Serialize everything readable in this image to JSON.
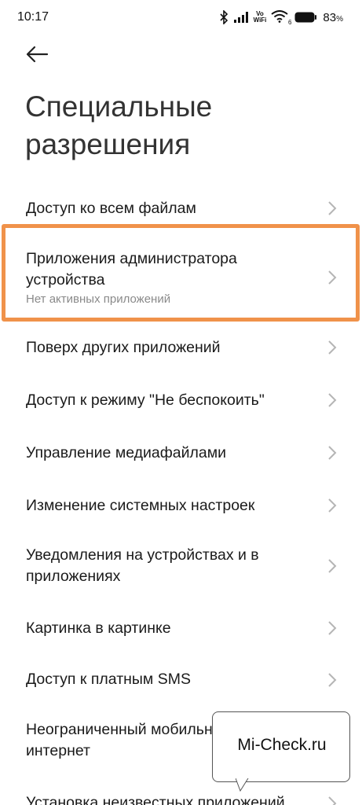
{
  "status_bar": {
    "time": "10:17",
    "volte_top": "Vo",
    "volte_bottom": "WiFi",
    "wifi_badge": "6",
    "battery_percent": "83",
    "battery_percent_sign": "%",
    "icons": [
      "bluetooth-icon",
      "signal-icon",
      "wifi-icon",
      "battery-icon"
    ]
  },
  "header": {
    "back_icon": "arrow-left-icon",
    "title": "Специальные разрешения"
  },
  "items": [
    {
      "title": "Доступ ко всем файлам"
    },
    {
      "title": "Приложения администратора устройства",
      "subtitle": "Нет активных приложений"
    },
    {
      "title": "Поверх других приложений"
    },
    {
      "title": "Доступ к режиму \"Не беспокоить\""
    },
    {
      "title": "Управление медиафайлами"
    },
    {
      "title": "Изменение системных настроек"
    },
    {
      "title": "Уведомления на устройствах и в приложениях"
    },
    {
      "title": "Картинка в картинке"
    },
    {
      "title": "Доступ к платным SMS"
    },
    {
      "title": "Неограниченный мобильный интернет"
    },
    {
      "title": "Установка неизвестных приложений"
    }
  ],
  "watermark": {
    "text": "Mi-Check.ru"
  },
  "colors": {
    "highlight": "#f0924a",
    "chevron": "#b5b5b5"
  }
}
